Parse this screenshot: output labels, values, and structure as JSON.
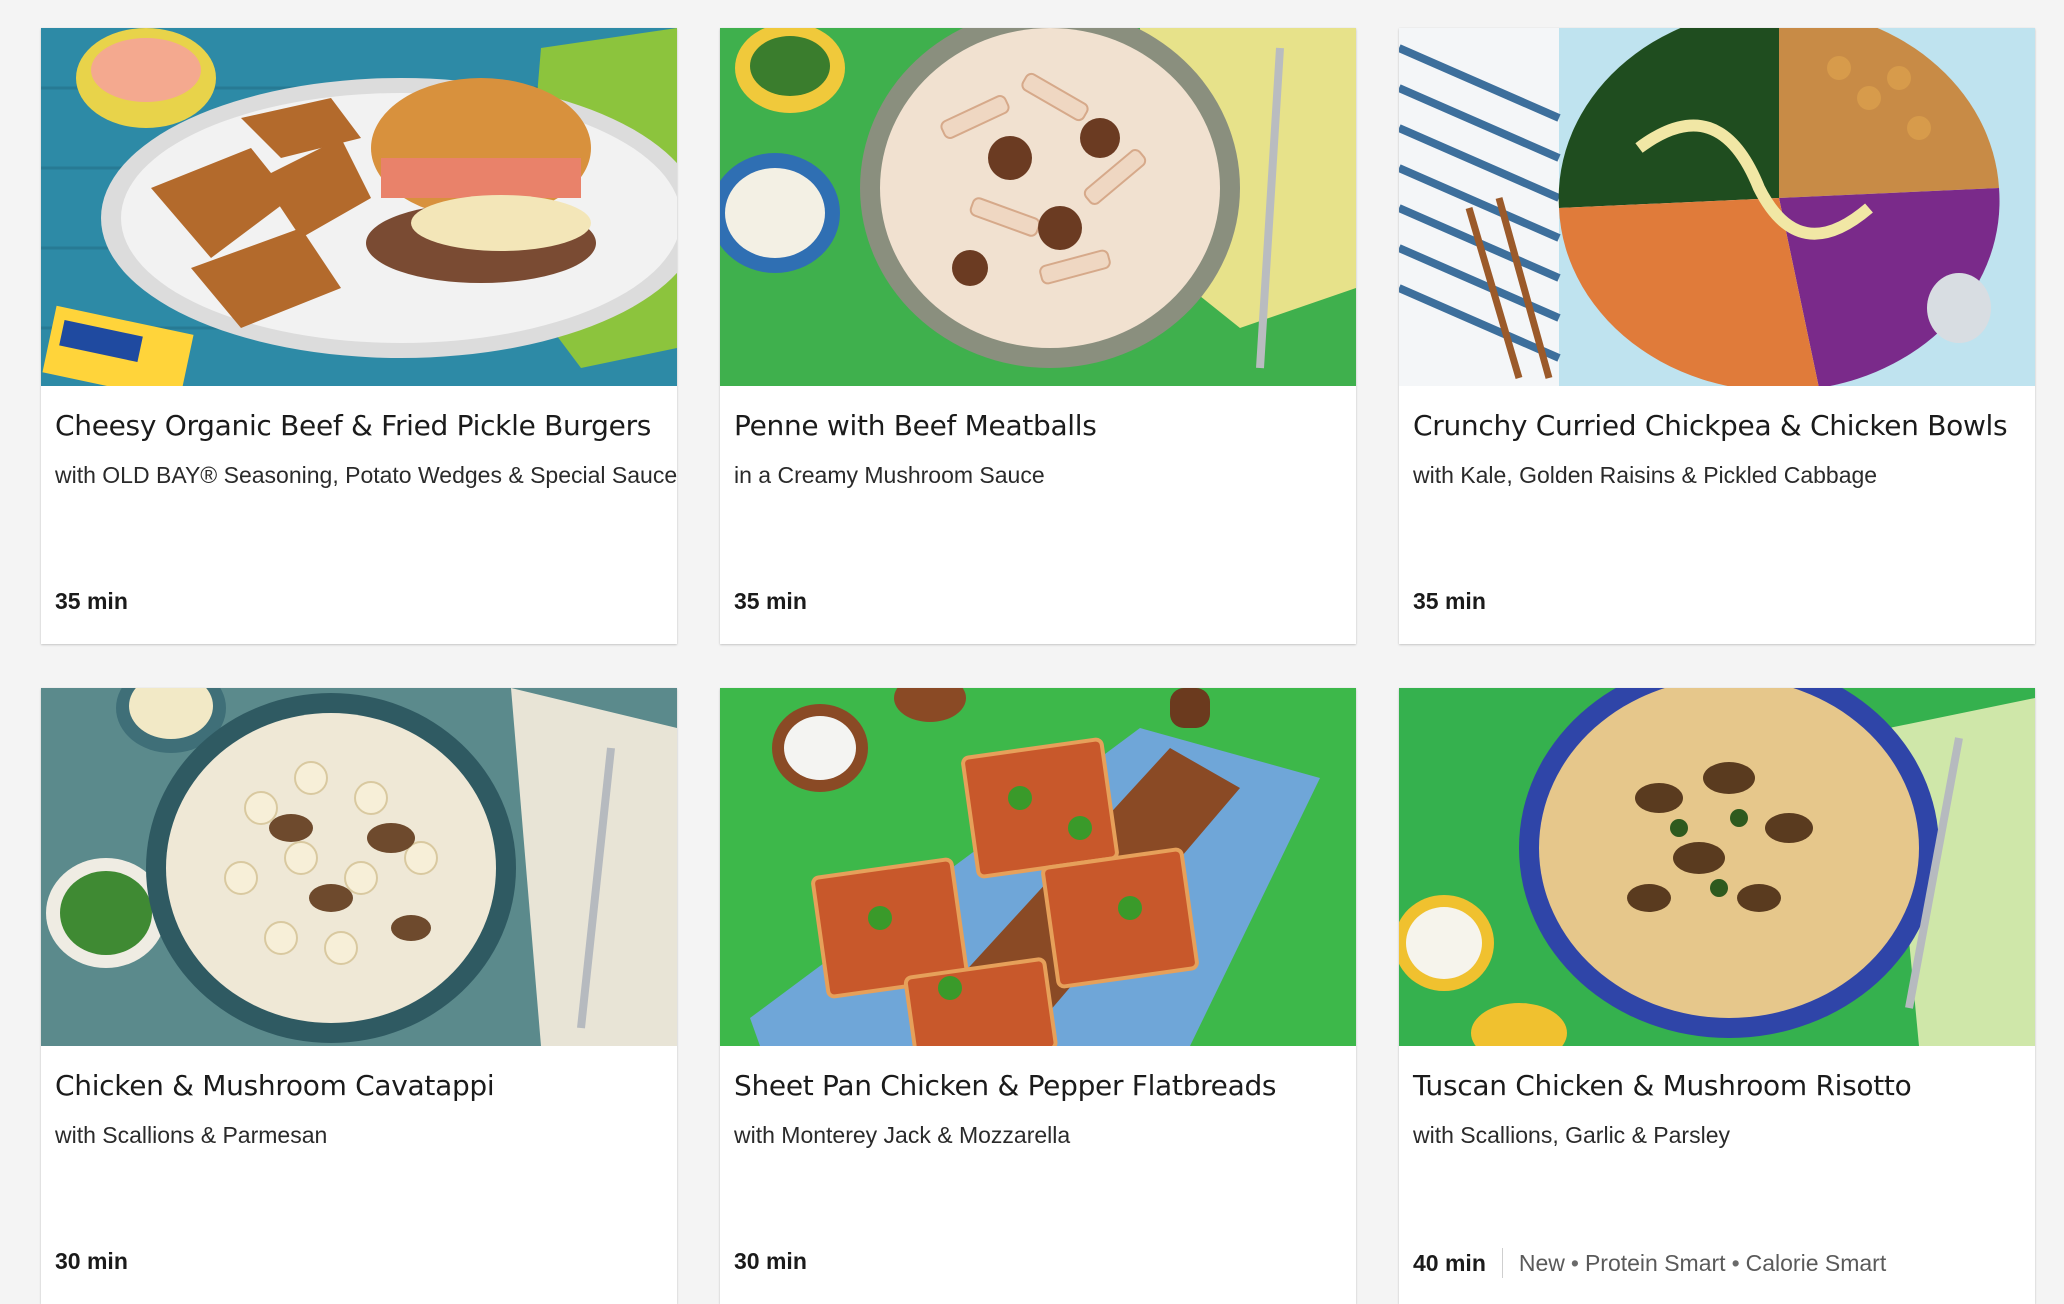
{
  "recipes": [
    {
      "title": "Cheesy Organic Beef & Fried Pickle Burgers",
      "subtitle": "with OLD BAY® Seasoning, Potato Wedges & Special Sauce",
      "time": "35 min",
      "tags": [],
      "image": "burger-and-potato-wedges-photo"
    },
    {
      "title": "Penne with Beef Meatballs",
      "subtitle": "in a Creamy Mushroom Sauce",
      "time": "35 min",
      "tags": [],
      "image": "penne-meatballs-bowl-photo"
    },
    {
      "title": "Crunchy Curried Chickpea & Chicken Bowls",
      "subtitle": "with Kale, Golden Raisins & Pickled Cabbage",
      "time": "35 min",
      "tags": [],
      "image": "chickpea-kale-bowl-photo"
    },
    {
      "title": "Chicken & Mushroom Cavatappi",
      "subtitle": "with Scallions & Parmesan",
      "time": "30 min",
      "tags": [],
      "image": "cavatappi-bowl-photo"
    },
    {
      "title": "Sheet Pan Chicken & Pepper Flatbreads",
      "subtitle": "with Monterey Jack & Mozzarella",
      "time": "30 min",
      "tags": [],
      "image": "flatbreads-on-board-photo"
    },
    {
      "title": "Tuscan Chicken & Mushroom Risotto",
      "subtitle": "with Scallions, Garlic & Parsley",
      "time": "40 min",
      "tags": [
        "New",
        "Protein Smart",
        "Calorie Smart"
      ],
      "image": "risotto-plate-photo"
    }
  ]
}
